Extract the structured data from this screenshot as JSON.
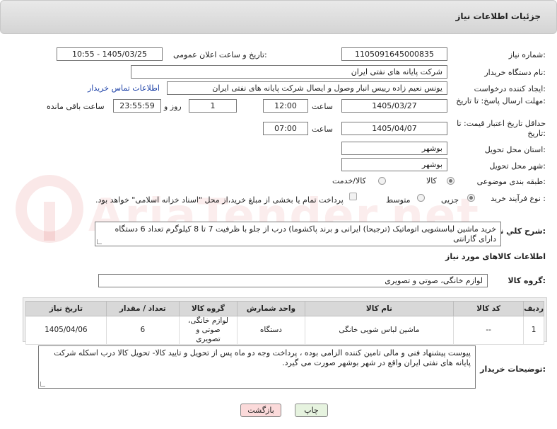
{
  "header": {
    "title": "جزئیات اطلاعات نیاز"
  },
  "labels": {
    "need_number": "شماره نیاز:",
    "announce_datetime": "تاریخ و ساعت اعلان عمومی:",
    "buyer_org": "نام دستگاه خریدار:",
    "requester": "ایجاد کننده درخواست:",
    "deadline": "مهلت ارسال پاسخ: تا تاریخ:",
    "time": "ساعت",
    "day_and": "روز و",
    "remaining": "ساعت باقی مانده",
    "price_validity": "حداقل تاریخ اعتبار قیمت: تا تاریخ:",
    "time2": "ساعت",
    "province": "استان محل تحویل:",
    "city": "شهر محل تحویل:",
    "category": "طبقه بندی موضوعی:",
    "purchase_type": "نوع فرآیند خرید :",
    "description": "شرح کلي نیاز:",
    "goods_info": "اطلاعات کالاهای مورد نیاز",
    "goods_group": "گروه کالا:",
    "buyer_notes": "توضیحات خریدار:"
  },
  "values": {
    "need_number": "1105091645000835",
    "announce_datetime": "1405/03/25 - 10:55",
    "buyer_org": "شرکت پایانه های نفتی ایران",
    "requester": "یونس نعیم زاده رییس انبار وصول و ایصال شرکت پایانه های نفتی ایران",
    "contact_link": "اطلاعات تماس خریدار",
    "deadline_date": "1405/03/27",
    "deadline_time": "12:00",
    "days": "1",
    "remaining_time": "23:55:59",
    "validity_date": "1405/04/07",
    "validity_time": "07:00",
    "province": "بوشهر",
    "city": "بوشهر",
    "goods_group": "لوازم خانگی، صوتی و تصویری"
  },
  "category_options": {
    "goods": "کالا",
    "goods_service": "کالا/خدمت",
    "selected": "کالا"
  },
  "purchase_options": {
    "partial": "جزیی",
    "medium": "متوسط",
    "selected": "جزیی",
    "treasury_note": "پرداخت تمام یا بخشی از مبلغ خرید،از محل \"اسناد خزانه اسلامی\" خواهد بود."
  },
  "description": "خرید ماشین لباسشویی اتوماتیک (ترجیحا) ایرانی و برند پاکشوما) درب از جلو با ظرفیت 7 تا 8 کیلوگرم تعداد 6 دستگاه دارای گارانتی",
  "table": {
    "headers": [
      "ردیف",
      "کد کالا",
      "نام کالا",
      "واحد شمارش",
      "گروه کالا",
      "تعداد / مقدار",
      "تاریخ نیاز"
    ],
    "rows": [
      [
        "1",
        "--",
        "ماشین لباس شویی خانگی",
        "دستگاه",
        "لوازم خانگی، صوتی و تصویری",
        "6",
        "1405/04/06"
      ]
    ]
  },
  "buyer_notes": "پیوست پیشنهاد فنی و مالی تامین کننده الزامی بوده ، پرداخت وجه دو ماه پس از تحویل و تایید کالا- تحویل کالا درب اسکله شرکت پایانه های نفتی ایران واقع در شهر بوشهر صورت می گیرد.",
  "buttons": {
    "print": "چاپ",
    "back": "بازگشت"
  },
  "watermark": "AriaTender.net"
}
